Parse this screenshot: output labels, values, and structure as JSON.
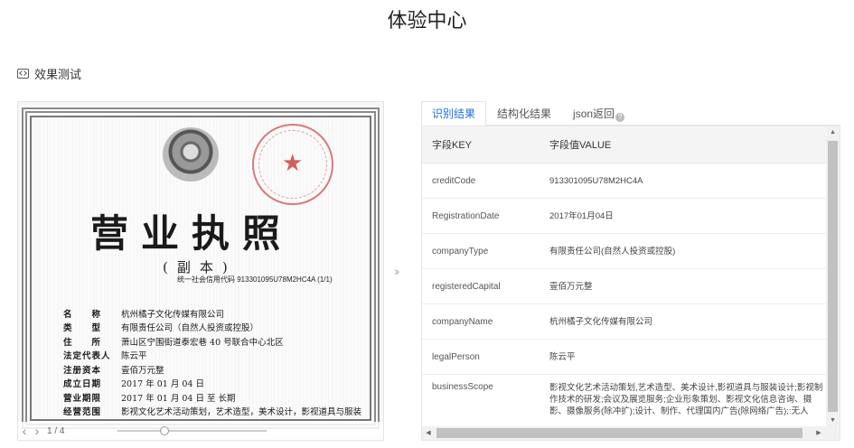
{
  "page": {
    "title": "体验中心"
  },
  "section": {
    "label": "效果测试",
    "icon": "code-icon"
  },
  "document": {
    "title": "营业执照",
    "subtitle": "(副本)",
    "credit_line": "统一社会信用代码 913301095U78M2HC4A (1/1)",
    "fields": [
      {
        "key": "名　　称",
        "value": "杭州橘子文化传媒有限公司"
      },
      {
        "key": "类　　型",
        "value": "有限责任公司（自然人投资或控股）"
      },
      {
        "key": "住　　所",
        "value": "萧山区宁围街道泰宏巷 40 号联合中心北区"
      },
      {
        "key": "法定代表人",
        "value": "陈云平"
      },
      {
        "key": "注册资本",
        "value": "壹佰万元整"
      },
      {
        "key": "成立日期",
        "value": "2017 年 01 月 04 日"
      },
      {
        "key": "营业期限",
        "value": "2017 年 01 月 04 日 至 长期"
      },
      {
        "key": "经营范围",
        "value": "影视文化艺术活动策划，艺术造型，美术设计，影视道具与服装"
      }
    ]
  },
  "pager": {
    "prev": "‹",
    "next": "›",
    "count": "1 / 4",
    "zoom_level": 0.3
  },
  "tabs": [
    {
      "label": "识别结果",
      "active": true
    },
    {
      "label": "结构化结果",
      "active": false
    },
    {
      "label": "json返回",
      "active": false,
      "help": "?"
    }
  ],
  "table": {
    "headers": {
      "key": "字段KEY",
      "value": "字段值VALUE"
    },
    "rows": [
      {
        "key": "creditCode",
        "value": "913301095U78M2HC4A"
      },
      {
        "key": "RegistrationDate",
        "value": "2017年01月04日"
      },
      {
        "key": "companyType",
        "value": "有限责任公司(自然人投资或控股)"
      },
      {
        "key": "registeredCapital",
        "value": "壹佰万元整"
      },
      {
        "key": "companyName",
        "value": "杭州橘子文化传媒有限公司"
      },
      {
        "key": "legalPerson",
        "value": "陈云平"
      },
      {
        "key": "businessScope",
        "value": "影视文化艺术活动策划,艺术造型、美术设计,影视道具与服装设计;影视制作技术的研发;会议及展览服务;企业形象策划、影视文化信息咨询、摄影、摄像服务(除冲扩);设计、制作、代理国内广告(除网络广告);:无人"
      }
    ]
  },
  "colors": {
    "accent": "#1e6fd9",
    "seal": "#d06060"
  }
}
